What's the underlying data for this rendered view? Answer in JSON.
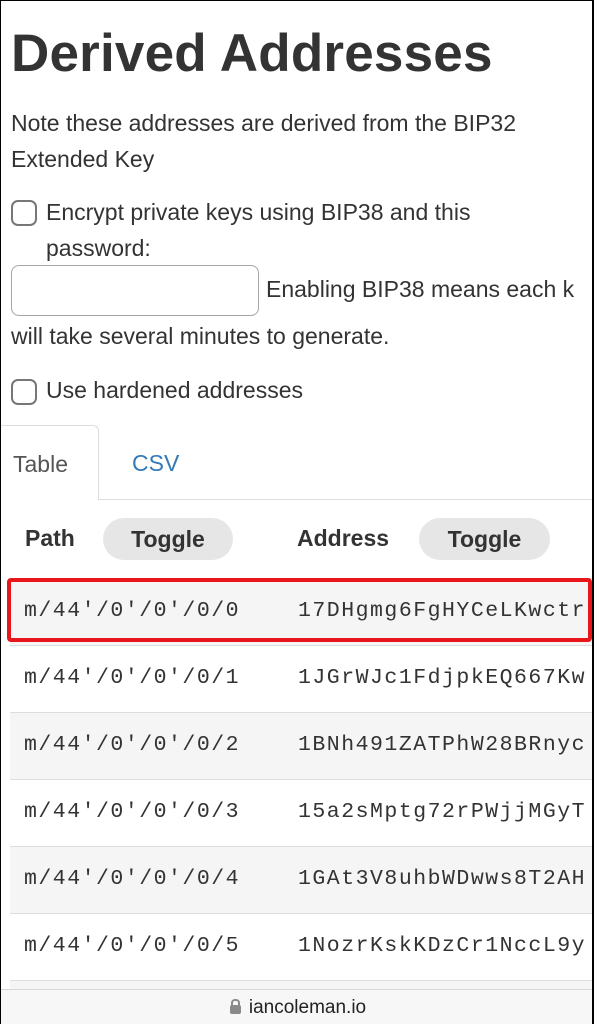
{
  "page": {
    "title": "Derived Addresses",
    "note": "Note these addresses are derived from the BIP32 Extended Key"
  },
  "options": {
    "bip38_label_line1": "Encrypt private keys using BIP38 and this",
    "bip38_label_line2": "password:",
    "bip38_password_value": "",
    "bip38_hint_line1": "Enabling BIP38 means each k",
    "bip38_hint_line2": "will take several minutes to generate.",
    "hardened_label": "Use hardened addresses"
  },
  "tabs": [
    {
      "label": "Table",
      "active": true
    },
    {
      "label": "CSV",
      "active": false
    }
  ],
  "table": {
    "columns": [
      {
        "label": "Path",
        "toggle_label": "Toggle"
      },
      {
        "label": "Address",
        "toggle_label": "Toggle"
      }
    ],
    "rows": [
      {
        "path": "m/44'/0'/0'/0/0",
        "address": "17DHgmg6FgHYCeLKwctr"
      },
      {
        "path": "m/44'/0'/0'/0/1",
        "address": "1JGrWJc1FdjpkEQ667Kw"
      },
      {
        "path": "m/44'/0'/0'/0/2",
        "address": "1BNh491ZATPhW28BRnyc"
      },
      {
        "path": "m/44'/0'/0'/0/3",
        "address": "15a2sMptg72rPWjjMGyT"
      },
      {
        "path": "m/44'/0'/0'/0/4",
        "address": "1GAt3V8uhbWDwws8T2AH"
      },
      {
        "path": "m/44'/0'/0'/0/5",
        "address": "1NozrKskKDzCr1NccL9y"
      }
    ],
    "highlighted_row": 0
  },
  "browser": {
    "url": "iancoleman.io",
    "lock_icon": "lock-icon"
  },
  "colors": {
    "highlight": "#e8161b",
    "link": "#337ab7",
    "toggle_bg": "#e6e6e6"
  }
}
